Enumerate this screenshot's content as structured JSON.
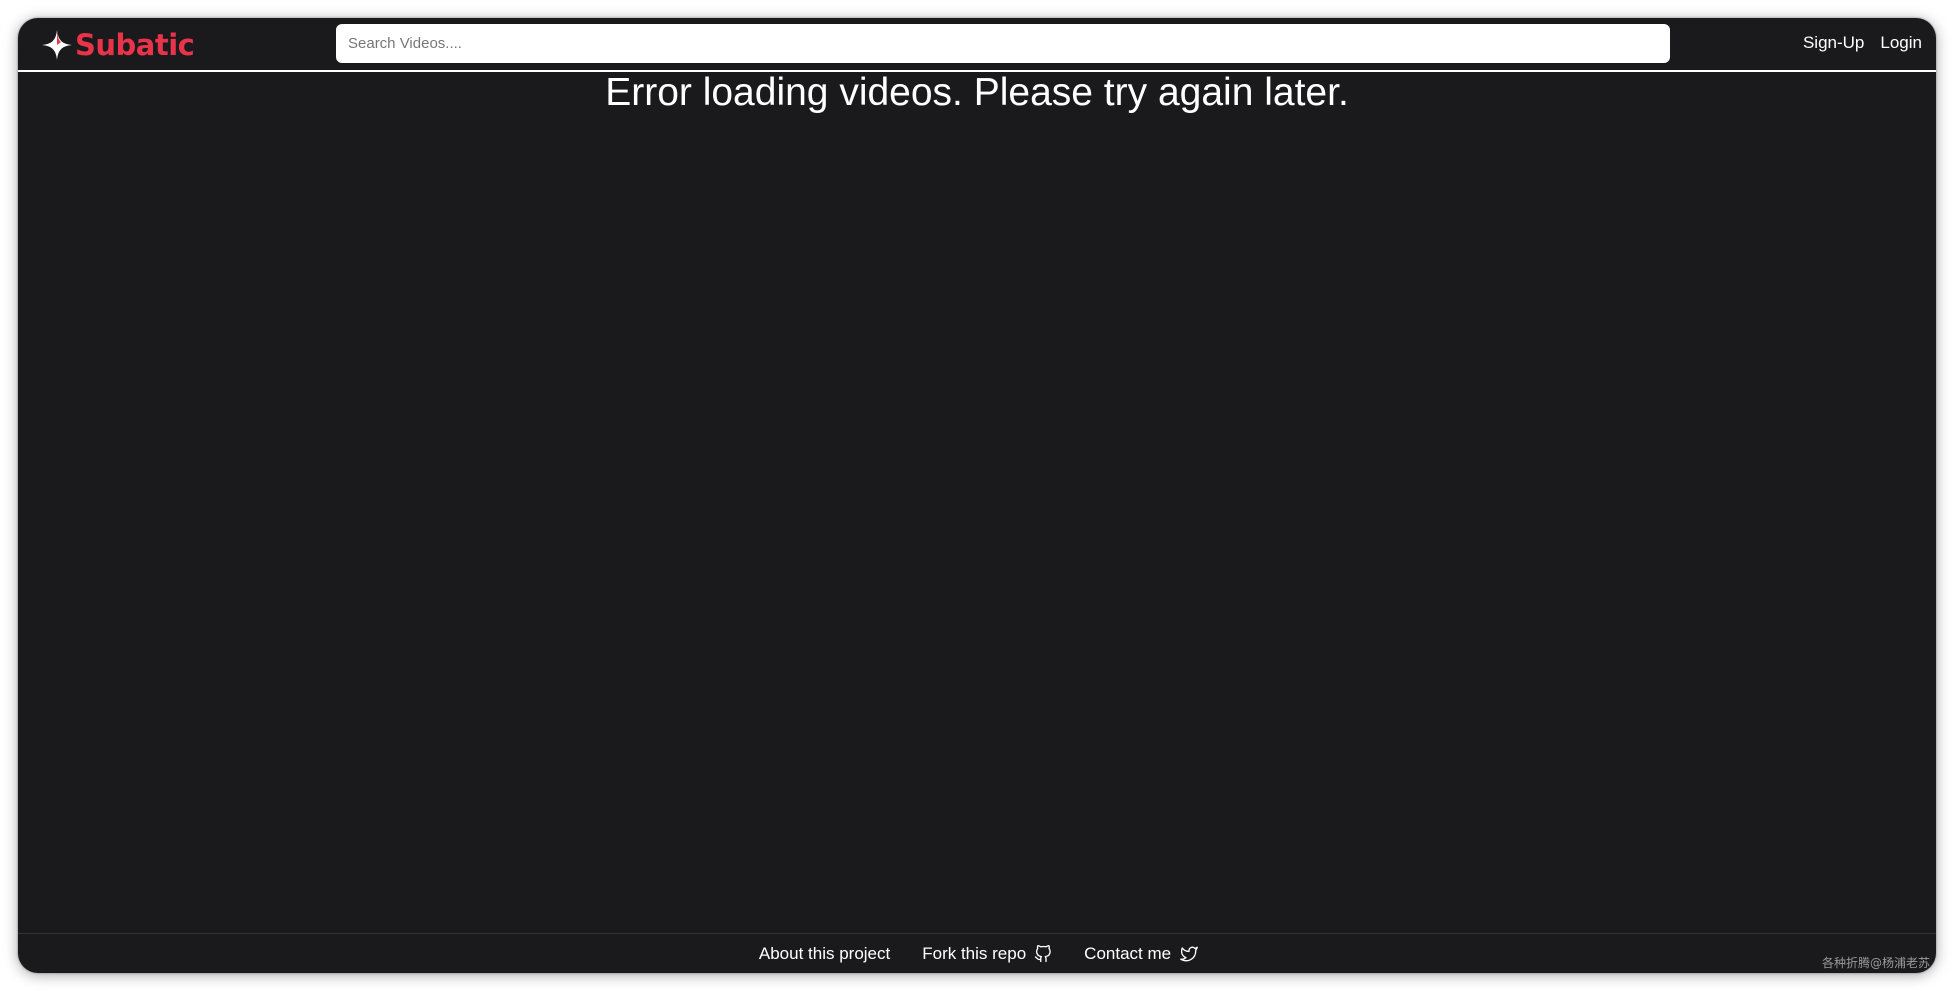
{
  "app": {
    "brand": "Subatic",
    "brand_color": "#e8334a",
    "background_color": "#1a1a1d"
  },
  "header": {
    "logo_icon": "four-point-star-icon",
    "search": {
      "placeholder": "Search Videos....",
      "value": ""
    },
    "signup_label": "Sign-Up",
    "login_label": "Login"
  },
  "main": {
    "error_message": "Error loading videos. Please try again later."
  },
  "footer": {
    "about_label": "About this project",
    "fork_label": "Fork this repo",
    "fork_icon": "github-icon",
    "contact_label": "Contact me",
    "contact_icon": "twitter-icon"
  },
  "watermark": "各种折腾@杨浦老苏"
}
